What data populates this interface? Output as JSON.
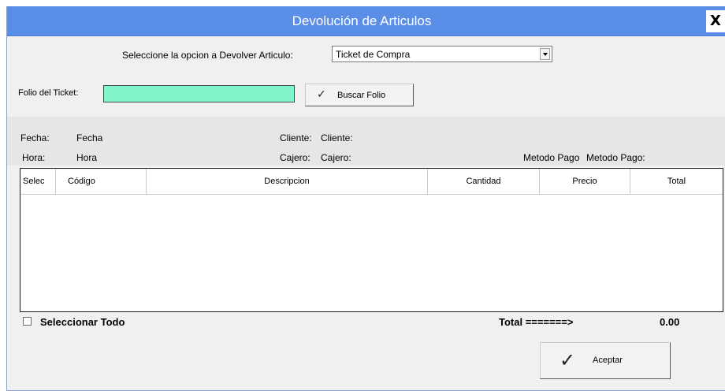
{
  "window": {
    "title": "Devolución de Articulos",
    "close_label": "X"
  },
  "selector": {
    "label": "Seleccione la  opcion a Devolver Articulo:",
    "value": "Ticket de Compra"
  },
  "folio": {
    "label": "Folio del Ticket:",
    "value": "",
    "search_button": "Buscar Folio"
  },
  "info": {
    "fecha_label": "Fecha:",
    "fecha_value": "Fecha",
    "hora_label": "Hora:",
    "hora_value": "Hora",
    "cliente_label": "Cliente:",
    "cliente_value": "Cliente:",
    "cajero_label": "Cajero:",
    "cajero_value": "Cajero:",
    "metodo_label": "Metodo Pago",
    "metodo_value": "Metodo Pago:"
  },
  "grid": {
    "columns": [
      "Selec",
      "Código",
      "Descripcion",
      "Cantidad",
      "Precio",
      "Total"
    ],
    "rows": []
  },
  "footer": {
    "select_all": "Seleccionar Todo",
    "total_label": "Total =======>",
    "total_value": "0.00",
    "accept_button": "Aceptar"
  },
  "colors": {
    "titlebar": "#5b8ee6",
    "folio_input": "#7ff5c9"
  }
}
